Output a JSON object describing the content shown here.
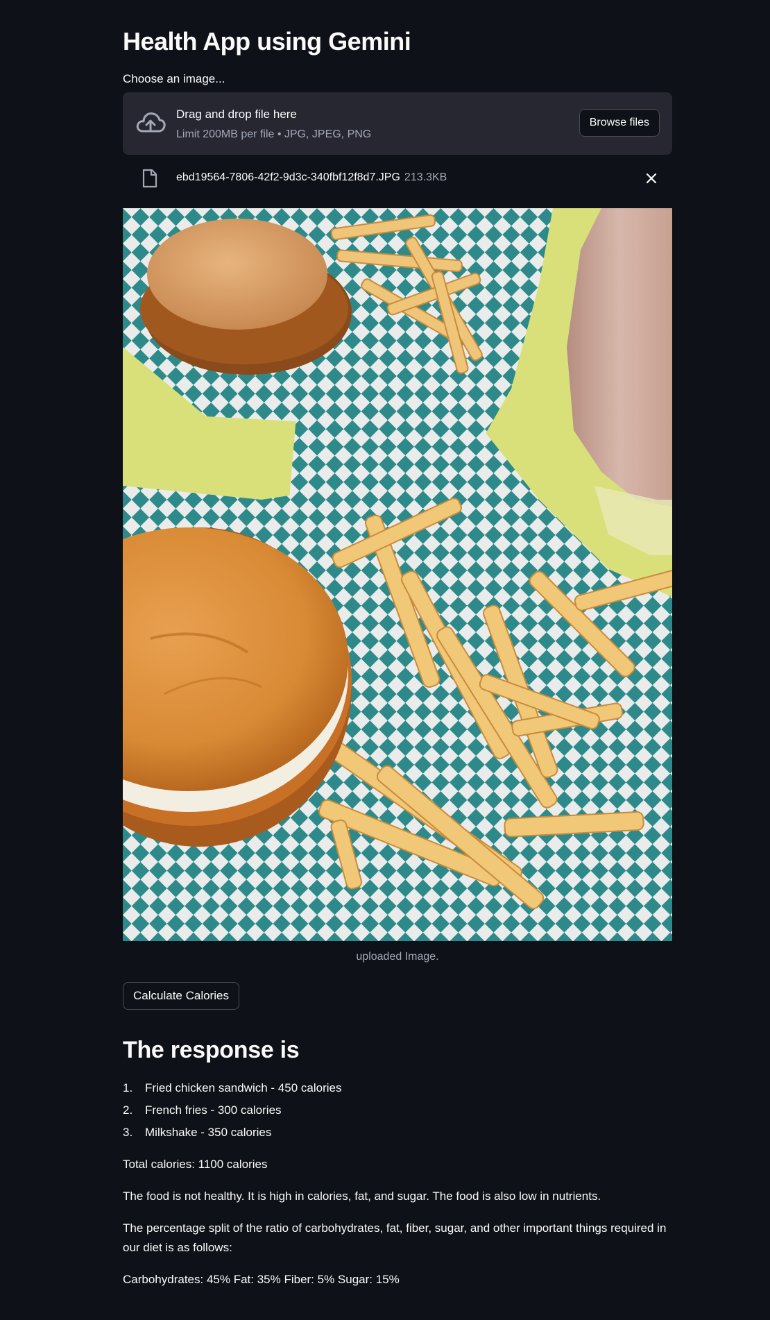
{
  "page": {
    "title": "Health App using Gemini"
  },
  "uploader": {
    "label": "Choose an image...",
    "drop_text": "Drag and drop file here",
    "limit_text": "Limit 200MB per file • JPG, JPEG, PNG",
    "browse_label": "Browse files",
    "icon": "cloud-upload-icon"
  },
  "uploaded_file": {
    "name": "ebd19564-7806-42f2-9d3c-340fbf12f8d7.JPG",
    "size": "213.3KB",
    "icon": "file-icon",
    "remove_icon": "close-icon"
  },
  "image": {
    "caption": "uploaded Image."
  },
  "actions": {
    "calculate_label": "Calculate Calories"
  },
  "response": {
    "heading": "The response is",
    "items": [
      {
        "num": "1.",
        "text": "Fried chicken sandwich - 450 calories"
      },
      {
        "num": "2.",
        "text": "French fries - 300 calories"
      },
      {
        "num": "3.",
        "text": "Milkshake - 350 calories"
      }
    ],
    "total": "Total calories: 1100 calories",
    "assessment": "The food is not healthy. It is high in calories, fat, and sugar. The food is also low in nutrients.",
    "split_intro": "The percentage split of the ratio of carbohydrates, fat, fiber, sugar, and other important things required in our diet is as follows:",
    "split_values": "Carbohydrates: 45% Fat: 35% Fiber: 5% Sugar: 15%"
  },
  "colors": {
    "background": "#0e1117",
    "surface": "#262730",
    "text": "#fafafa",
    "muted": "#a3a8b8",
    "checker_teal": "#2e8a8a",
    "table_yellow": "#d9df79"
  }
}
